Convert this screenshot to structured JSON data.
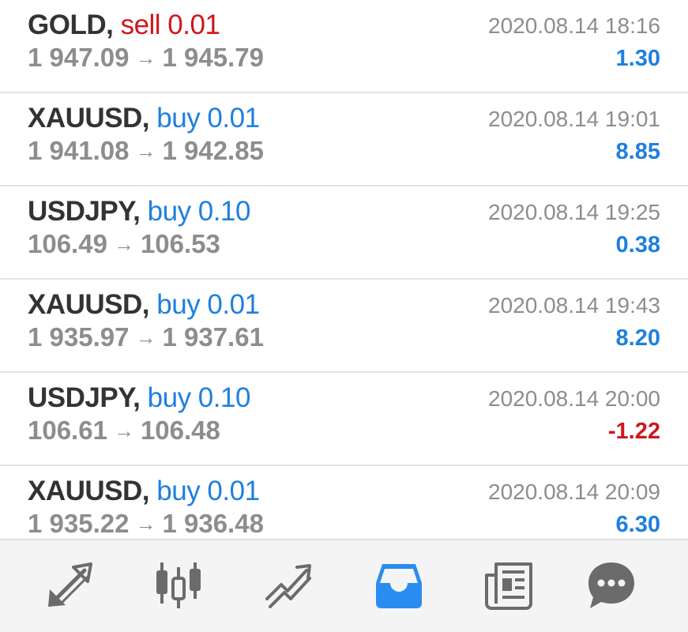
{
  "trades": [
    {
      "symbol": "GOLD,",
      "action": "sell 0.01",
      "side": "sell",
      "open": "1 947.09",
      "close": "1 945.79",
      "time": "2020.08.14 18:16",
      "profit": "1.30",
      "profit_sign": "pos"
    },
    {
      "symbol": "XAUUSD,",
      "action": "buy 0.01",
      "side": "buy",
      "open": "1 941.08",
      "close": "1 942.85",
      "time": "2020.08.14 19:01",
      "profit": "8.85",
      "profit_sign": "pos"
    },
    {
      "symbol": "USDJPY,",
      "action": "buy 0.10",
      "side": "buy",
      "open": "106.49",
      "close": "106.53",
      "time": "2020.08.14 19:25",
      "profit": "0.38",
      "profit_sign": "pos"
    },
    {
      "symbol": "XAUUSD,",
      "action": "buy 0.01",
      "side": "buy",
      "open": "1 935.97",
      "close": "1 937.61",
      "time": "2020.08.14 19:43",
      "profit": "8.20",
      "profit_sign": "pos"
    },
    {
      "symbol": "USDJPY,",
      "action": "buy 0.10",
      "side": "buy",
      "open": "106.61",
      "close": "106.48",
      "time": "2020.08.14 20:00",
      "profit": "-1.22",
      "profit_sign": "neg"
    },
    {
      "symbol": "XAUUSD,",
      "action": "buy 0.01",
      "side": "buy",
      "open": "1 935.22",
      "close": "1 936.48",
      "time": "2020.08.14 20:09",
      "profit": "6.30",
      "profit_sign": "pos"
    }
  ],
  "arrow_glyph": "→",
  "nav": {
    "items": [
      {
        "icon": "quotes-arrows-icon",
        "active": false
      },
      {
        "icon": "candlestick-chart-icon",
        "active": false
      },
      {
        "icon": "trade-trend-icon",
        "active": false
      },
      {
        "icon": "history-inbox-icon",
        "active": true
      },
      {
        "icon": "news-icon",
        "active": false
      },
      {
        "icon": "chat-icon",
        "active": false
      }
    ]
  },
  "colors": {
    "buy": "#1f7fe0",
    "sell": "#d0161c",
    "symbol": "#333333",
    "muted": "#8d8d8d",
    "nav_icon": "#6b6b6b",
    "nav_active": "#2a8cf0"
  }
}
